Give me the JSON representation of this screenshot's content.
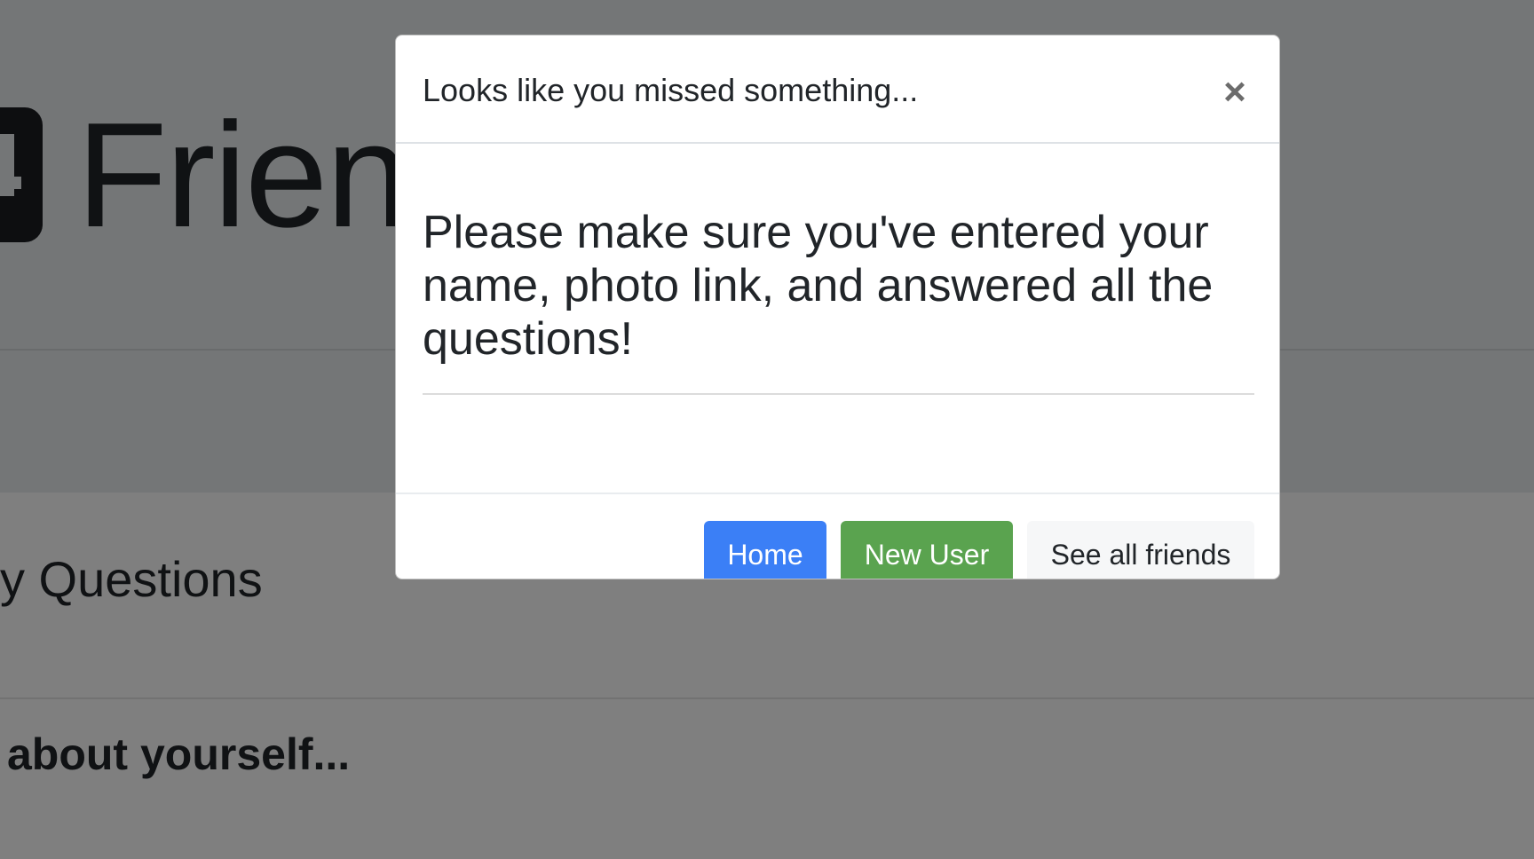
{
  "background": {
    "brand_text": "Frien",
    "section_heading": "y Questions",
    "question_heading": "about yourself..."
  },
  "modal": {
    "title": "Looks like you missed something...",
    "close_label": "×",
    "message": "Please make sure you've entered your name, photo link, and answered all the questions!",
    "buttons": {
      "home": "Home",
      "new_user": "New User",
      "see_all_friends": "See all friends"
    }
  },
  "colors": {
    "primary": "#3b7ff6",
    "success": "#5aa34f",
    "light": "#f6f7f8",
    "backdrop": "rgba(0,0,0,0.5)"
  }
}
